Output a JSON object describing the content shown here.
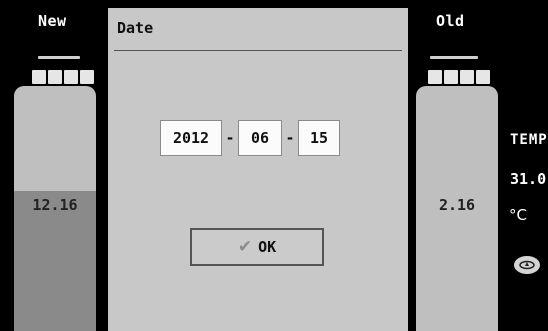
{
  "left_panel": {
    "title": "New",
    "battery_value": "12.16",
    "battery_level": 0.57
  },
  "dialog": {
    "title": "Date",
    "year": "2012",
    "month": "06",
    "day": "15",
    "separator": "-",
    "ok_label": "OK",
    "ok_icon": "check-icon"
  },
  "right_panel": {
    "title": "Old",
    "battery_value": "2.16",
    "temp_label": "TEMP",
    "temp_value": "31.0",
    "temp_unit": "°C",
    "status_icon": "oil-can-icon"
  },
  "colors": {
    "background": "#000000",
    "dialog": "#c8c8c8",
    "battery": "#bfbfbf",
    "battery_fill": "#8a8a8a"
  }
}
